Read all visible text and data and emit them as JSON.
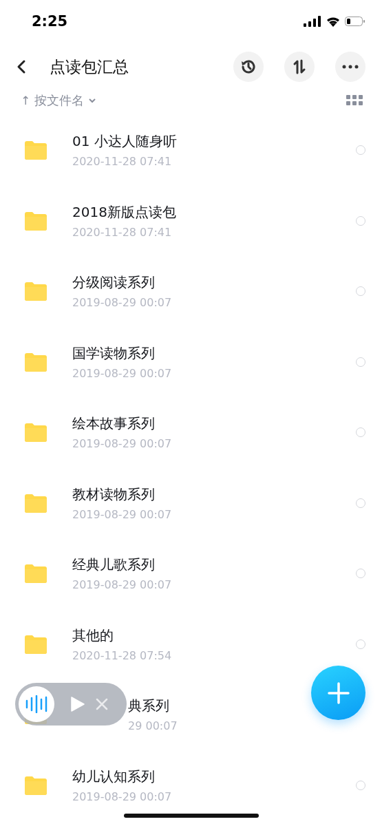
{
  "status_bar": {
    "time": "2:25"
  },
  "nav": {
    "title": "点读包汇总"
  },
  "sort": {
    "arrow": "↑",
    "label": "按文件名"
  },
  "files": [
    {
      "name": "01 小达人随身听",
      "date": "2020-11-28 07:41",
      "selected": false
    },
    {
      "name": "2018新版点读包",
      "date": "2020-11-28 07:41",
      "selected": false
    },
    {
      "name": "分级阅读系列",
      "date": "2019-08-29 00:07",
      "selected": false
    },
    {
      "name": "国学读物系列",
      "date": "2019-08-29 00:07",
      "selected": false
    },
    {
      "name": "绘本故事系列",
      "date": "2019-08-29 00:07",
      "selected": false
    },
    {
      "name": "教材读物系列",
      "date": "2019-08-29 00:07",
      "selected": false
    },
    {
      "name": "经典儿歌系列",
      "date": "2019-08-29 00:07",
      "selected": false
    },
    {
      "name": "其他的",
      "date": "2020-11-28 07:54",
      "selected": false
    },
    {
      "name": "典系列",
      "date": "29 00:07",
      "kind": "covered"
    },
    {
      "name": "幼儿认知系列",
      "date": "2019-08-29 00:07",
      "selected": false
    }
  ]
}
